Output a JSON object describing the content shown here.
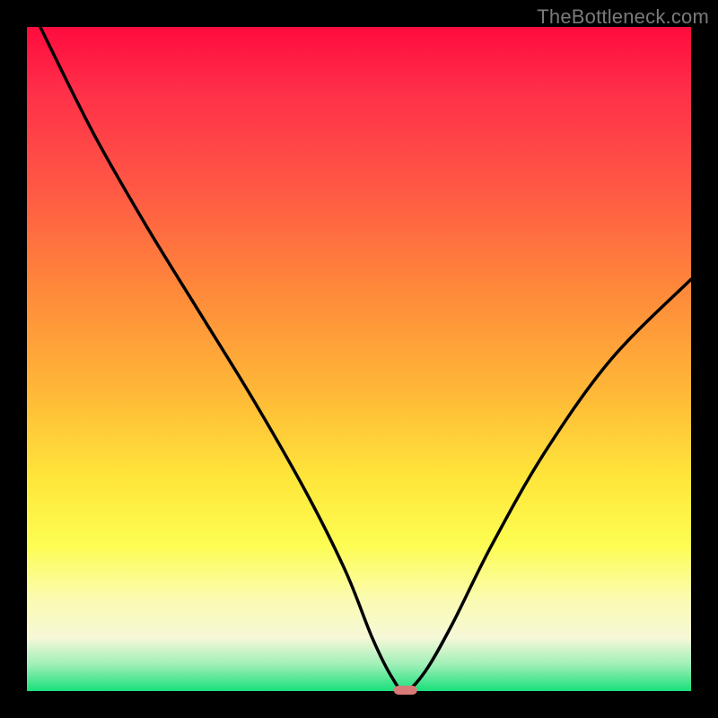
{
  "watermark": "TheBottleneck.com",
  "chart_data": {
    "type": "line",
    "title": "",
    "xlabel": "",
    "ylabel": "",
    "xlim": [
      0,
      100
    ],
    "ylim": [
      0,
      100
    ],
    "series": [
      {
        "name": "bottleneck-curve",
        "x": [
          2,
          10,
          18,
          26,
          34,
          42,
          48,
          52,
          55,
          57,
          60,
          64,
          70,
          78,
          88,
          100
        ],
        "values": [
          100,
          84,
          70,
          57,
          44,
          30,
          18,
          8,
          2,
          0,
          3,
          10,
          22,
          36,
          50,
          62
        ]
      }
    ],
    "min_marker": {
      "x": 57,
      "y": 0
    },
    "colors": {
      "curve": "#000000",
      "marker": "#d87b78",
      "gradient_top": "#ff0b3e",
      "gradient_bottom": "#18e07a"
    }
  }
}
